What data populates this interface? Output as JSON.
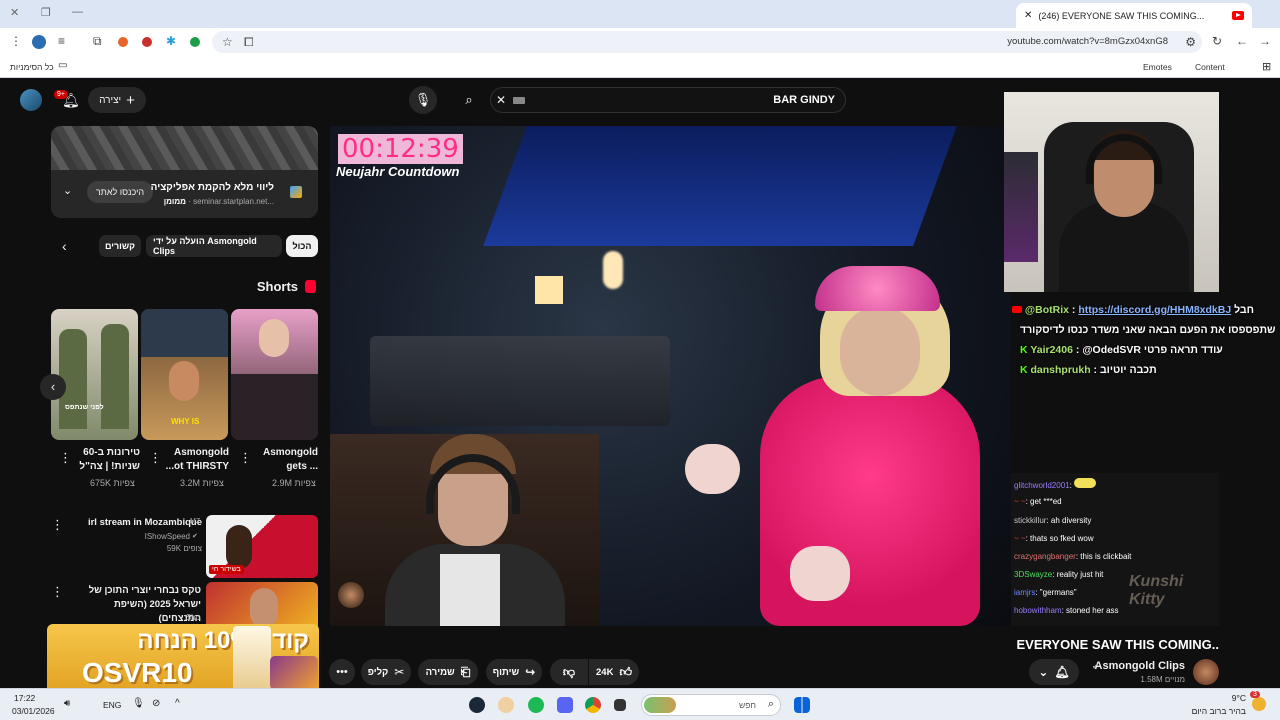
{
  "browser": {
    "tab_title": "(246) EVERYONE SAW THIS COMING...",
    "url": "youtube.com/watch?v=8mGzx04xnG8",
    "bookmarks_left": "כל הסימניות",
    "bookmarks_right": [
      "Content",
      "Emotes"
    ]
  },
  "youtube": {
    "search_query": "BAR GINDY",
    "create_label": "יצירה",
    "notif_count": "9+",
    "ad": {
      "title": "ליווי מלא להקמת אפליקציה",
      "sponsor": "ממומן",
      "domain": "seminar.startplan.net...",
      "button": "היכנסו לאתר"
    },
    "chips": [
      "הכול",
      "הועלה על ידי Asmongold Clips",
      "קשורים"
    ],
    "shorts_label": "Shorts",
    "shorts": [
      {
        "title": "Asmongold gets ...",
        "views": "2.9M צפיות"
      },
      {
        "title": "Asmongold ...ot THIRSTY",
        "views": "3.2M צפיות"
      },
      {
        "title": "טירונות ב-60 שניות! | צה\"ל",
        "views": "675K צפיות"
      }
    ],
    "shorts_text": [
      "WHY IS",
      "לפני שנתפס"
    ],
    "related": [
      {
        "title": "irl stream in Mozambique",
        "channel": "IShowSpeed",
        "meta": "59K צופים",
        "badge": "בשידור חי"
      },
      {
        "title": "טקס נבחרי יוצרי התוכן של ישראל 2025 (השיפת המנצחים)",
        "channel": "Sho"
      }
    ],
    "video": {
      "timer": "00:12:39",
      "timer_label": "Neujahr Countdown",
      "title": "EVERYONE SAW THIS COMING..",
      "watermark": "Kunshi Kitty"
    },
    "overlay_chat": [
      {
        "user": "@BotRix",
        "text": "https://discord.gg/HHM8xdkBJ"
      },
      {
        "user": "",
        "text": "שתפספסו את הפעם הבאה שאני משדר כנסו לדיסקורד"
      },
      {
        "user": "Yair2406",
        "text": "@OdedSVR עודד תראה פרטי"
      },
      {
        "user": "danshprukh",
        "text": "תכבה יוטיוב"
      }
    ],
    "small_chat": [
      {
        "user": "glitchworld2001",
        "text": ""
      },
      {
        "user": "~ ~",
        "text": "get ***ed"
      },
      {
        "user": "stickkillur",
        "text": "ah diversity"
      },
      {
        "user": "~ ~",
        "text": "thats so fked wow"
      },
      {
        "user": "crazygangbanger",
        "text": "this is clickbait"
      },
      {
        "user": "3DSwayze",
        "text": "reality just hit"
      },
      {
        "user": "iamjrs",
        "text": "\"germans\""
      },
      {
        "user": "hobowithham",
        "text": "stoned her ass"
      }
    ],
    "actions": {
      "likes": "24K",
      "share": "שיתוף",
      "save": "שמירה",
      "clip": "קליפ"
    },
    "channel": {
      "name": "Asmongold Clips",
      "subs": "1.58M מנויים"
    },
    "promo": {
      "line1": "קוד ל10% הנחה",
      "line2": "OSVR10"
    }
  },
  "taskbar": {
    "weather": "9°C",
    "weather_desc": "בהיר ברוב היום",
    "search_placeholder": "חפש",
    "lang": "ENG",
    "time": "17:22",
    "date": "03/01/2026",
    "badge": "3"
  },
  "colors": {
    "yt_red": "#ff0033",
    "chrome_tab_bar": "#dbe5f3",
    "pink_coat": "#ff2d86"
  }
}
